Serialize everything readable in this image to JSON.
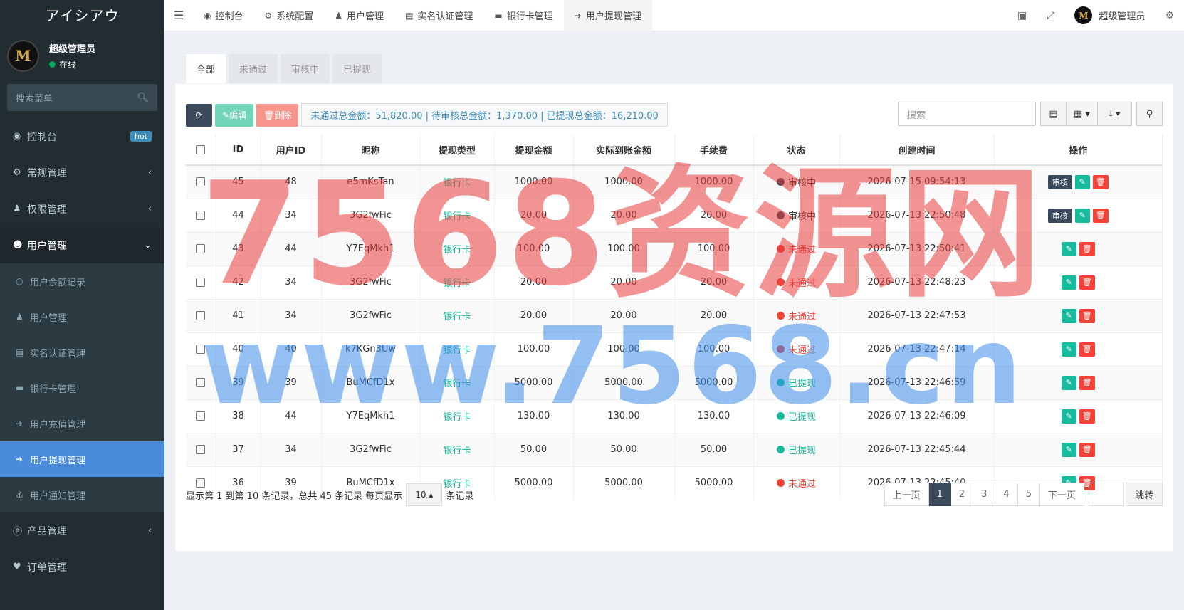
{
  "app": {
    "title": "アイシアウ"
  },
  "user": {
    "name": "超级管理员",
    "status": "在线",
    "avatar_letter": "M"
  },
  "sidebar": {
    "search_placeholder": "搜索菜单",
    "items": [
      {
        "label": "控制台",
        "icon": "dashboard-icon",
        "badge": "hot"
      },
      {
        "label": "常规管理",
        "icon": "cogs-icon"
      },
      {
        "label": "权限管理",
        "icon": "users-group-icon"
      },
      {
        "label": "用户管理",
        "icon": "user-circle-icon"
      }
    ],
    "submenu": [
      {
        "label": "用户余额记录",
        "icon": "circle-outline-icon"
      },
      {
        "label": "用户管理",
        "icon": "user-icon"
      },
      {
        "label": "实名认证管理",
        "icon": "id-card-icon"
      },
      {
        "label": "银行卡管理",
        "icon": "credit-card-icon"
      },
      {
        "label": "用户充值管理",
        "icon": "sign-in-icon"
      },
      {
        "label": "用户提现管理",
        "icon": "sign-out-icon"
      },
      {
        "label": "用户通知管理",
        "icon": "anchor-icon"
      }
    ],
    "bottom_items": [
      {
        "label": "产品管理",
        "icon": "product-p-icon"
      },
      {
        "label": "订单管理",
        "icon": "heartbeat-icon"
      }
    ]
  },
  "topnav": {
    "tabs": [
      {
        "label": "控制台",
        "icon": "dashboard-icon"
      },
      {
        "label": "系统配置",
        "icon": "gear-icon"
      },
      {
        "label": "用户管理",
        "icon": "user-icon"
      },
      {
        "label": "实名认证管理",
        "icon": "id-card-icon"
      },
      {
        "label": "银行卡管理",
        "icon": "credit-card-icon"
      },
      {
        "label": "用户提现管理",
        "icon": "sign-out-icon"
      }
    ],
    "admin_name": "超级管理员"
  },
  "filter_tabs": [
    "全部",
    "未通过",
    "审核中",
    "已提现"
  ],
  "toolbar": {
    "edit_label": "编辑",
    "delete_label": "删除",
    "summary": "未通过总金额：51,820.00 | 待审核总金额：1,370.00 | 已提现总金额：16,210.00",
    "search_placeholder": "搜索"
  },
  "table": {
    "columns": [
      "ID",
      "用户ID",
      "昵称",
      "提现类型",
      "提现金额",
      "实际到账金额",
      "手续费",
      "状态",
      "创建时间",
      "操作"
    ],
    "audit_label": "审核",
    "rows": [
      {
        "id": "45",
        "uid": "48",
        "nick": "e5mKsTan",
        "type": "银行卡",
        "amount": "1000.00",
        "actual": "1000.00",
        "fee": "1000.00",
        "status": "审核中",
        "status_kind": "review",
        "time": "2026-07-15 09:54:13"
      },
      {
        "id": "44",
        "uid": "34",
        "nick": "3G2fwFic",
        "type": "银行卡",
        "amount": "20.00",
        "actual": "20.00",
        "fee": "20.00",
        "status": "审核中",
        "status_kind": "review",
        "time": "2026-07-13 22:50:48"
      },
      {
        "id": "43",
        "uid": "44",
        "nick": "Y7EqMkh1",
        "type": "银行卡",
        "amount": "100.00",
        "actual": "100.00",
        "fee": "100.00",
        "status": "未通过",
        "status_kind": "reject",
        "time": "2026-07-13 22:50:41"
      },
      {
        "id": "42",
        "uid": "34",
        "nick": "3G2fwFic",
        "type": "银行卡",
        "amount": "20.00",
        "actual": "20.00",
        "fee": "20.00",
        "status": "未通过",
        "status_kind": "reject",
        "time": "2026-07-13 22:48:23"
      },
      {
        "id": "41",
        "uid": "34",
        "nick": "3G2fwFic",
        "type": "银行卡",
        "amount": "20.00",
        "actual": "20.00",
        "fee": "20.00",
        "status": "未通过",
        "status_kind": "reject",
        "time": "2026-07-13 22:47:53"
      },
      {
        "id": "40",
        "uid": "40",
        "nick": "k7KGn3Uw",
        "type": "银行卡",
        "amount": "100.00",
        "actual": "100.00",
        "fee": "100.00",
        "status": "未通过",
        "status_kind": "reject",
        "time": "2026-07-13 22:47:14"
      },
      {
        "id": "39",
        "uid": "39",
        "nick": "BuMCfD1x",
        "type": "银行卡",
        "amount": "5000.00",
        "actual": "5000.00",
        "fee": "5000.00",
        "status": "已提现",
        "status_kind": "done",
        "time": "2026-07-13 22:46:59"
      },
      {
        "id": "38",
        "uid": "44",
        "nick": "Y7EqMkh1",
        "type": "银行卡",
        "amount": "130.00",
        "actual": "130.00",
        "fee": "130.00",
        "status": "已提现",
        "status_kind": "done",
        "time": "2026-07-13 22:46:09"
      },
      {
        "id": "37",
        "uid": "34",
        "nick": "3G2fwFic",
        "type": "银行卡",
        "amount": "50.00",
        "actual": "50.00",
        "fee": "50.00",
        "status": "已提现",
        "status_kind": "done",
        "time": "2026-07-13 22:45:44"
      },
      {
        "id": "36",
        "uid": "39",
        "nick": "BuMCfD1x",
        "type": "银行卡",
        "amount": "5000.00",
        "actual": "5000.00",
        "fee": "5000.00",
        "status": "未通过",
        "status_kind": "reject",
        "time": "2026-07-13 22:45:40"
      }
    ]
  },
  "pagination": {
    "info_prefix": "显示第 1 到第 10 条记录，总共 45 条记录 每页显示",
    "page_size": "10",
    "info_suffix": "条记录",
    "prev": "上一页",
    "pages": [
      "1",
      "2",
      "3",
      "4",
      "5"
    ],
    "current": "1",
    "next": "下一页",
    "jump": "跳转"
  },
  "watermark": {
    "line1": "7568资源网",
    "line2": "www.7568.cn"
  },
  "colors": {
    "sidebar_bg": "#222d32",
    "active_menu": "#4a8bdc",
    "success": "#18bc9c",
    "danger": "#f44336",
    "primary_dark": "#3c4a5d"
  }
}
